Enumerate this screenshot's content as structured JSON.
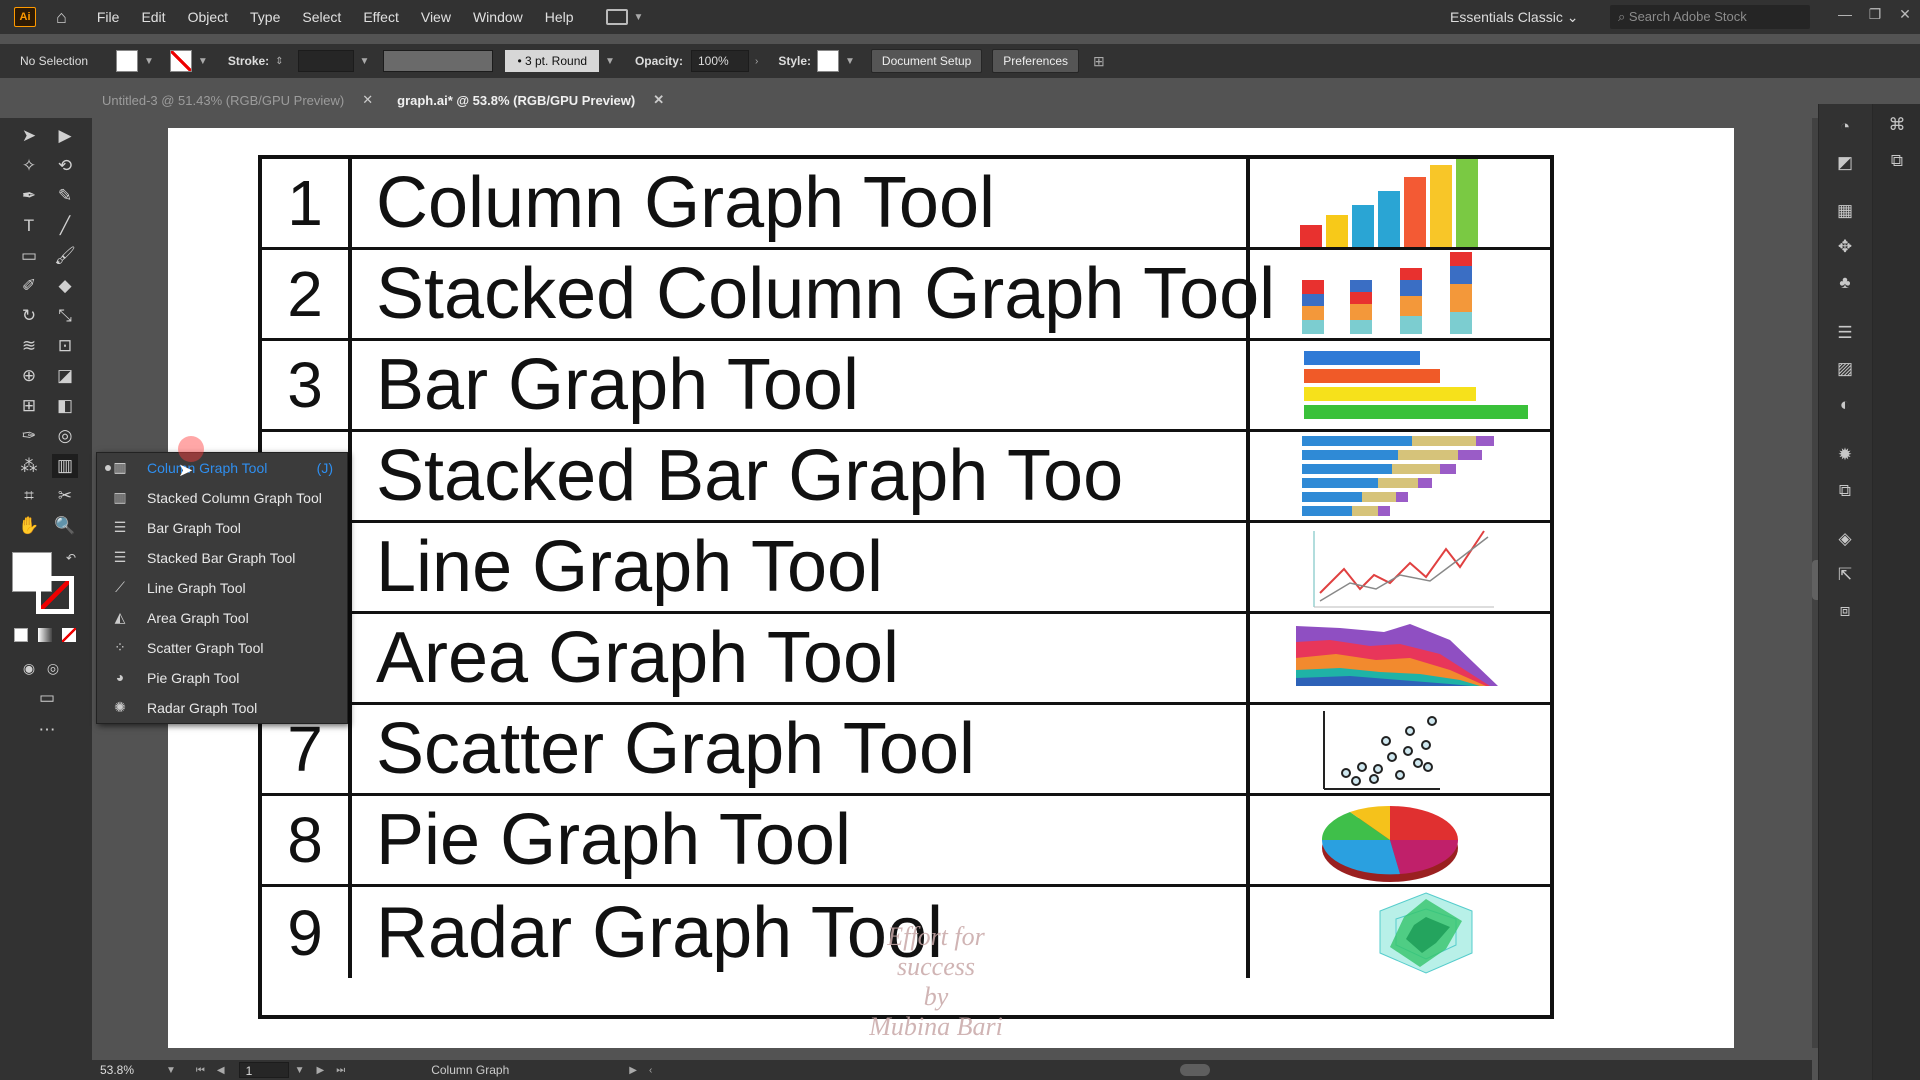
{
  "app": {
    "logo_text": "Ai",
    "workspace": "Essentials Classic",
    "stock_placeholder": "Search Adobe Stock"
  },
  "menu": [
    "File",
    "Edit",
    "Object",
    "Type",
    "Select",
    "Effect",
    "View",
    "Window",
    "Help"
  ],
  "control_bar": {
    "selection": "No Selection",
    "stroke_label": "Stroke:",
    "brush": "3 pt. Round",
    "opacity_label": "Opacity:",
    "opacity_value": "100%",
    "style_label": "Style:",
    "document_setup": "Document Setup",
    "preferences": "Preferences"
  },
  "tabs": [
    {
      "label": "Untitled-3 @ 51.43% (RGB/GPU Preview)",
      "active": false
    },
    {
      "label": "graph.ai* @ 53.8% (RGB/GPU Preview)",
      "active": true
    }
  ],
  "flyout": {
    "items": [
      {
        "label": "Column Graph Tool",
        "shortcut": "(J)",
        "icon": "column-graph-icon"
      },
      {
        "label": "Stacked Column Graph Tool",
        "icon": "stacked-column-graph-icon"
      },
      {
        "label": "Bar Graph Tool",
        "icon": "bar-graph-icon"
      },
      {
        "label": "Stacked Bar Graph Tool",
        "icon": "stacked-bar-graph-icon"
      },
      {
        "label": "Line Graph Tool",
        "icon": "line-graph-icon"
      },
      {
        "label": "Area Graph Tool",
        "icon": "area-graph-icon"
      },
      {
        "label": "Scatter Graph Tool",
        "icon": "scatter-graph-icon"
      },
      {
        "label": "Pie Graph Tool",
        "icon": "pie-graph-icon"
      },
      {
        "label": "Radar Graph Tool",
        "icon": "radar-graph-icon"
      }
    ]
  },
  "table": {
    "rows": [
      {
        "num": "1",
        "name": "Column Graph Tool"
      },
      {
        "num": "2",
        "name": "Stacked Column Graph Tool"
      },
      {
        "num": "3",
        "name": "Bar Graph Tool"
      },
      {
        "num": "",
        "name": "Stacked Bar Graph Too"
      },
      {
        "num": "",
        "name": "Line Graph Tool"
      },
      {
        "num": "",
        "name": "Area Graph Tool"
      },
      {
        "num": "7",
        "name": "Scatter Graph Tool"
      },
      {
        "num": "8",
        "name": "Pie Graph Tool"
      },
      {
        "num": "9",
        "name": "Radar Graph Tool"
      }
    ]
  },
  "watermark": {
    "line1": "Effort for success",
    "line2": "by",
    "line3": "Mubina Bari"
  },
  "status": {
    "zoom": "53.8%",
    "page": "1",
    "tool": "Column Graph"
  },
  "colors": {
    "accent": "#2f8ff0",
    "bar_colors": [
      "#e8312f",
      "#f7c919",
      "#2aa5d4",
      "#f35a34",
      "#f8c628",
      "#7ac943"
    ]
  }
}
